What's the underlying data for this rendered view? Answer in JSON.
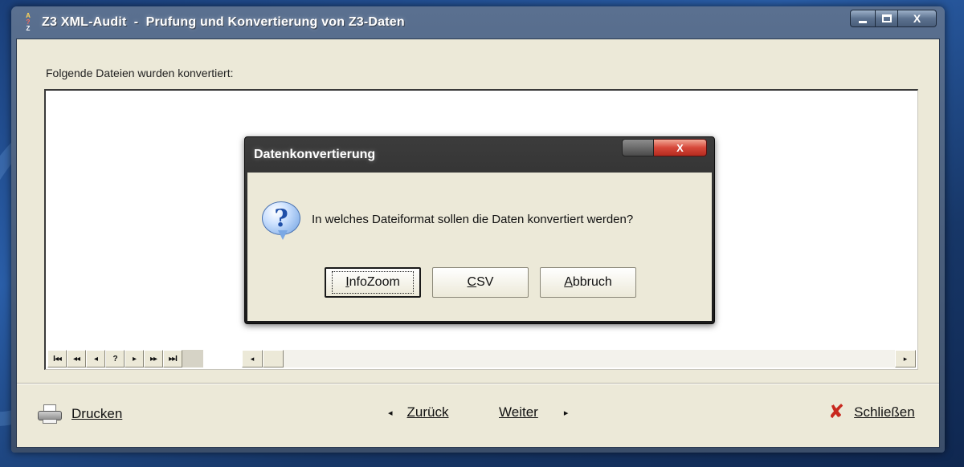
{
  "window": {
    "title": "Z3 XML-Audit  -  Prufung und Konvertierung von Z3-Daten",
    "icon_top": "A",
    "icon_mid": "?",
    "icon_bottom": "Z",
    "minimize_icon": "window-minimize-icon",
    "maximize_icon": "window-maximize-icon",
    "close_label": "X"
  },
  "content": {
    "section_label": "Folgende Dateien wurden konvertiert:"
  },
  "navbar": {
    "first": "I◂◂",
    "prev_page": "◂◂",
    "prev": "◂",
    "help": "?",
    "next": "▸",
    "next_page": "▸▸",
    "last": "▸▸I"
  },
  "scrollbar": {
    "left": "◂",
    "right": "▸"
  },
  "bottom_bar": {
    "print_label": "Drucken",
    "back_label": "Zurück",
    "next_label": "Weiter",
    "close_label": "Schließen",
    "back_arrow": "◂",
    "next_arrow": "▸",
    "close_x": "✘"
  },
  "dialog": {
    "title": "Datenkonvertierung",
    "close_label": "X",
    "question_mark": "?",
    "message": "In welches Dateiformat sollen die Daten konvertiert werden?",
    "buttons": {
      "infozoom": "InfoZoom",
      "csv": "CSV",
      "abort": "Abbruch"
    }
  }
}
